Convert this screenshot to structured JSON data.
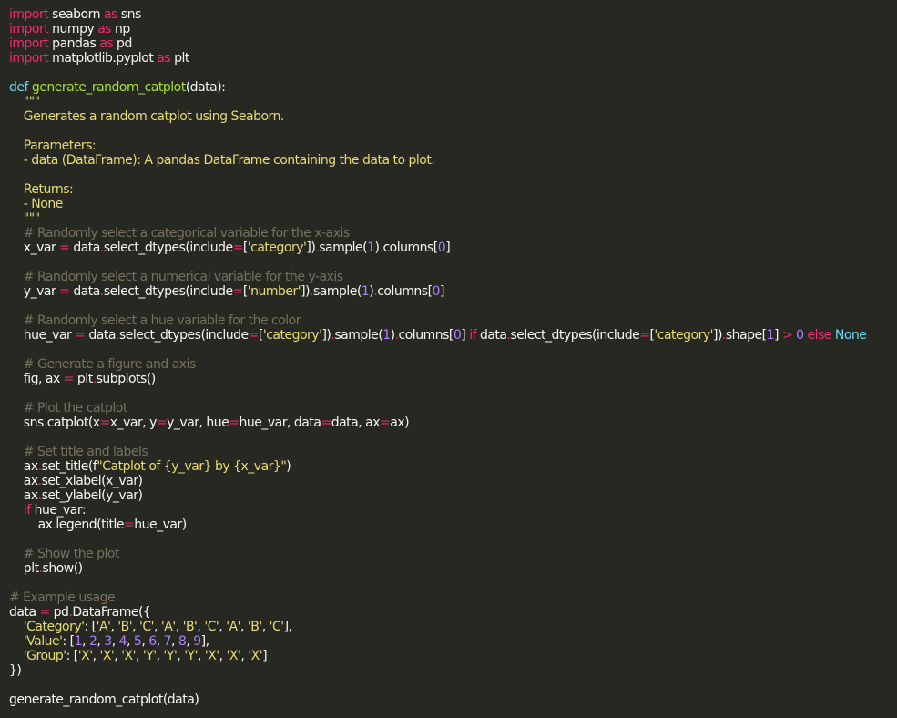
{
  "editor": {
    "theme_colors": {
      "background": "#272822",
      "text": "#f8f8f2",
      "keyword": "#66d9ef",
      "function": "#a6e22e",
      "string": "#e6db74",
      "comment": "#75715e",
      "number": "#ae81ff",
      "operator": "#f92672"
    },
    "lines": [
      [
        {
          "t": "import",
          "c": "import"
        },
        {
          "t": " seaborn ",
          "c": "plain"
        },
        {
          "t": "as",
          "c": "import"
        },
        {
          "t": " sns",
          "c": "plain"
        }
      ],
      [
        {
          "t": "import",
          "c": "import"
        },
        {
          "t": " numpy ",
          "c": "plain"
        },
        {
          "t": "as",
          "c": "import"
        },
        {
          "t": " np",
          "c": "plain"
        }
      ],
      [
        {
          "t": "import",
          "c": "import"
        },
        {
          "t": " pandas ",
          "c": "plain"
        },
        {
          "t": "as",
          "c": "import"
        },
        {
          "t": " pd",
          "c": "plain"
        }
      ],
      [
        {
          "t": "import",
          "c": "import"
        },
        {
          "t": " matplotlib.pyplot ",
          "c": "plain"
        },
        {
          "t": "as",
          "c": "import"
        },
        {
          "t": " plt",
          "c": "plain"
        }
      ],
      [],
      [
        {
          "t": "def",
          "c": "keyword"
        },
        {
          "t": " ",
          "c": "plain"
        },
        {
          "t": "generate_random_catplot",
          "c": "func"
        },
        {
          "t": "(data):",
          "c": "plain"
        }
      ],
      [
        {
          "t": "    \"\"\"",
          "c": "docstring"
        }
      ],
      [
        {
          "t": "    Generates a random catplot using Seaborn.",
          "c": "docstring"
        }
      ],
      [],
      [
        {
          "t": "    Parameters:",
          "c": "docstring"
        }
      ],
      [
        {
          "t": "    - data (DataFrame): A pandas DataFrame containing the data to plot.",
          "c": "docstring"
        }
      ],
      [],
      [
        {
          "t": "    Returns:",
          "c": "docstring"
        }
      ],
      [
        {
          "t": "    - None",
          "c": "docstring"
        }
      ],
      [
        {
          "t": "    \"\"\"",
          "c": "docstring"
        }
      ],
      [
        {
          "t": "    # Randomly select a categorical variable for the x-axis",
          "c": "comment"
        }
      ],
      [
        {
          "t": "    x_var ",
          "c": "plain"
        },
        {
          "t": "=",
          "c": "op"
        },
        {
          "t": " data",
          "c": "plain"
        },
        {
          "t": ".",
          "c": "op"
        },
        {
          "t": "select_dtypes(include",
          "c": "plain"
        },
        {
          "t": "=",
          "c": "op"
        },
        {
          "t": "[",
          "c": "plain"
        },
        {
          "t": "'category'",
          "c": "string"
        },
        {
          "t": "])",
          "c": "plain"
        },
        {
          "t": ".",
          "c": "op"
        },
        {
          "t": "sample(",
          "c": "plain"
        },
        {
          "t": "1",
          "c": "number"
        },
        {
          "t": ")",
          "c": "plain"
        },
        {
          "t": ".",
          "c": "op"
        },
        {
          "t": "columns[",
          "c": "plain"
        },
        {
          "t": "0",
          "c": "number"
        },
        {
          "t": "]",
          "c": "plain"
        }
      ],
      [],
      [
        {
          "t": "    # Randomly select a numerical variable for the y-axis",
          "c": "comment"
        }
      ],
      [
        {
          "t": "    y_var ",
          "c": "plain"
        },
        {
          "t": "=",
          "c": "op"
        },
        {
          "t": " data",
          "c": "plain"
        },
        {
          "t": ".",
          "c": "op"
        },
        {
          "t": "select_dtypes(include",
          "c": "plain"
        },
        {
          "t": "=",
          "c": "op"
        },
        {
          "t": "[",
          "c": "plain"
        },
        {
          "t": "'number'",
          "c": "string"
        },
        {
          "t": "])",
          "c": "plain"
        },
        {
          "t": ".",
          "c": "op"
        },
        {
          "t": "sample(",
          "c": "plain"
        },
        {
          "t": "1",
          "c": "number"
        },
        {
          "t": ")",
          "c": "plain"
        },
        {
          "t": ".",
          "c": "op"
        },
        {
          "t": "columns[",
          "c": "plain"
        },
        {
          "t": "0",
          "c": "number"
        },
        {
          "t": "]",
          "c": "plain"
        }
      ],
      [],
      [
        {
          "t": "    # Randomly select a hue variable for the color",
          "c": "comment"
        }
      ],
      [
        {
          "t": "    hue_var ",
          "c": "plain"
        },
        {
          "t": "=",
          "c": "op"
        },
        {
          "t": " data",
          "c": "plain"
        },
        {
          "t": ".",
          "c": "op"
        },
        {
          "t": "select_dtypes(include",
          "c": "plain"
        },
        {
          "t": "=",
          "c": "op"
        },
        {
          "t": "[",
          "c": "plain"
        },
        {
          "t": "'category'",
          "c": "string"
        },
        {
          "t": "])",
          "c": "plain"
        },
        {
          "t": ".",
          "c": "op"
        },
        {
          "t": "sample(",
          "c": "plain"
        },
        {
          "t": "1",
          "c": "number"
        },
        {
          "t": ")",
          "c": "plain"
        },
        {
          "t": ".",
          "c": "op"
        },
        {
          "t": "columns[",
          "c": "plain"
        },
        {
          "t": "0",
          "c": "number"
        },
        {
          "t": "] ",
          "c": "plain"
        },
        {
          "t": "if",
          "c": "import"
        },
        {
          "t": " data",
          "c": "plain"
        },
        {
          "t": ".",
          "c": "op"
        },
        {
          "t": "select_dtypes(include",
          "c": "plain"
        },
        {
          "t": "=",
          "c": "op"
        },
        {
          "t": "[",
          "c": "plain"
        },
        {
          "t": "'category'",
          "c": "string"
        },
        {
          "t": "])",
          "c": "plain"
        },
        {
          "t": ".",
          "c": "op"
        },
        {
          "t": "shape[",
          "c": "plain"
        },
        {
          "t": "1",
          "c": "number"
        },
        {
          "t": "] ",
          "c": "plain"
        },
        {
          "t": ">",
          "c": "op"
        },
        {
          "t": " ",
          "c": "plain"
        },
        {
          "t": "0",
          "c": "number"
        },
        {
          "t": " ",
          "c": "plain"
        },
        {
          "t": "else",
          "c": "import"
        },
        {
          "t": " ",
          "c": "plain"
        },
        {
          "t": "None",
          "c": "keyword"
        }
      ],
      [],
      [
        {
          "t": "    # Generate a figure and axis",
          "c": "comment"
        }
      ],
      [
        {
          "t": "    fig, ax ",
          "c": "plain"
        },
        {
          "t": "=",
          "c": "op"
        },
        {
          "t": " plt",
          "c": "plain"
        },
        {
          "t": ".",
          "c": "op"
        },
        {
          "t": "subplots()",
          "c": "plain"
        }
      ],
      [],
      [
        {
          "t": "    # Plot the catplot",
          "c": "comment"
        }
      ],
      [
        {
          "t": "    sns",
          "c": "plain"
        },
        {
          "t": ".",
          "c": "op"
        },
        {
          "t": "catplot(x",
          "c": "plain"
        },
        {
          "t": "=",
          "c": "op"
        },
        {
          "t": "x_var, y",
          "c": "plain"
        },
        {
          "t": "=",
          "c": "op"
        },
        {
          "t": "y_var, hue",
          "c": "plain"
        },
        {
          "t": "=",
          "c": "op"
        },
        {
          "t": "hue_var, data",
          "c": "plain"
        },
        {
          "t": "=",
          "c": "op"
        },
        {
          "t": "data, ax",
          "c": "plain"
        },
        {
          "t": "=",
          "c": "op"
        },
        {
          "t": "ax)",
          "c": "plain"
        }
      ],
      [],
      [
        {
          "t": "    # Set title and labels",
          "c": "comment"
        }
      ],
      [
        {
          "t": "    ax",
          "c": "plain"
        },
        {
          "t": ".",
          "c": "op"
        },
        {
          "t": "set_title(f",
          "c": "plain"
        },
        {
          "t": "\"Catplot of {y_var} by {x_var}\"",
          "c": "string"
        },
        {
          "t": ")",
          "c": "plain"
        }
      ],
      [
        {
          "t": "    ax",
          "c": "plain"
        },
        {
          "t": ".",
          "c": "op"
        },
        {
          "t": "set_xlabel(x_var)",
          "c": "plain"
        }
      ],
      [
        {
          "t": "    ax",
          "c": "plain"
        },
        {
          "t": ".",
          "c": "op"
        },
        {
          "t": "set_ylabel(y_var)",
          "c": "plain"
        }
      ],
      [
        {
          "t": "    ",
          "c": "plain"
        },
        {
          "t": "if",
          "c": "import"
        },
        {
          "t": " hue_var:",
          "c": "plain"
        }
      ],
      [
        {
          "t": "        ax",
          "c": "plain"
        },
        {
          "t": ".",
          "c": "op"
        },
        {
          "t": "legend(title",
          "c": "plain"
        },
        {
          "t": "=",
          "c": "op"
        },
        {
          "t": "hue_var)",
          "c": "plain"
        }
      ],
      [],
      [
        {
          "t": "    # Show the plot",
          "c": "comment"
        }
      ],
      [
        {
          "t": "    plt",
          "c": "plain"
        },
        {
          "t": ".",
          "c": "op"
        },
        {
          "t": "show()",
          "c": "plain"
        }
      ],
      [],
      [
        {
          "t": "# Example usage",
          "c": "comment"
        }
      ],
      [
        {
          "t": "data ",
          "c": "plain"
        },
        {
          "t": "=",
          "c": "op"
        },
        {
          "t": " pd",
          "c": "plain"
        },
        {
          "t": ".",
          "c": "op"
        },
        {
          "t": "DataFrame({",
          "c": "plain"
        }
      ],
      [
        {
          "t": "    ",
          "c": "plain"
        },
        {
          "t": "'Category'",
          "c": "string"
        },
        {
          "t": ": [",
          "c": "plain"
        },
        {
          "t": "'A'",
          "c": "string"
        },
        {
          "t": ", ",
          "c": "plain"
        },
        {
          "t": "'B'",
          "c": "string"
        },
        {
          "t": ", ",
          "c": "plain"
        },
        {
          "t": "'C'",
          "c": "string"
        },
        {
          "t": ", ",
          "c": "plain"
        },
        {
          "t": "'A'",
          "c": "string"
        },
        {
          "t": ", ",
          "c": "plain"
        },
        {
          "t": "'B'",
          "c": "string"
        },
        {
          "t": ", ",
          "c": "plain"
        },
        {
          "t": "'C'",
          "c": "string"
        },
        {
          "t": ", ",
          "c": "plain"
        },
        {
          "t": "'A'",
          "c": "string"
        },
        {
          "t": ", ",
          "c": "plain"
        },
        {
          "t": "'B'",
          "c": "string"
        },
        {
          "t": ", ",
          "c": "plain"
        },
        {
          "t": "'C'",
          "c": "string"
        },
        {
          "t": "],",
          "c": "plain"
        }
      ],
      [
        {
          "t": "    ",
          "c": "plain"
        },
        {
          "t": "'Value'",
          "c": "string"
        },
        {
          "t": ": [",
          "c": "plain"
        },
        {
          "t": "1",
          "c": "number"
        },
        {
          "t": ", ",
          "c": "plain"
        },
        {
          "t": "2",
          "c": "number"
        },
        {
          "t": ", ",
          "c": "plain"
        },
        {
          "t": "3",
          "c": "number"
        },
        {
          "t": ", ",
          "c": "plain"
        },
        {
          "t": "4",
          "c": "number"
        },
        {
          "t": ", ",
          "c": "plain"
        },
        {
          "t": "5",
          "c": "number"
        },
        {
          "t": ", ",
          "c": "plain"
        },
        {
          "t": "6",
          "c": "number"
        },
        {
          "t": ", ",
          "c": "plain"
        },
        {
          "t": "7",
          "c": "number"
        },
        {
          "t": ", ",
          "c": "plain"
        },
        {
          "t": "8",
          "c": "number"
        },
        {
          "t": ", ",
          "c": "plain"
        },
        {
          "t": "9",
          "c": "number"
        },
        {
          "t": "],",
          "c": "plain"
        }
      ],
      [
        {
          "t": "    ",
          "c": "plain"
        },
        {
          "t": "'Group'",
          "c": "string"
        },
        {
          "t": ": [",
          "c": "plain"
        },
        {
          "t": "'X'",
          "c": "string"
        },
        {
          "t": ", ",
          "c": "plain"
        },
        {
          "t": "'X'",
          "c": "string"
        },
        {
          "t": ", ",
          "c": "plain"
        },
        {
          "t": "'X'",
          "c": "string"
        },
        {
          "t": ", ",
          "c": "plain"
        },
        {
          "t": "'Y'",
          "c": "string"
        },
        {
          "t": ", ",
          "c": "plain"
        },
        {
          "t": "'Y'",
          "c": "string"
        },
        {
          "t": ", ",
          "c": "plain"
        },
        {
          "t": "'Y'",
          "c": "string"
        },
        {
          "t": ", ",
          "c": "plain"
        },
        {
          "t": "'X'",
          "c": "string"
        },
        {
          "t": ", ",
          "c": "plain"
        },
        {
          "t": "'X'",
          "c": "string"
        },
        {
          "t": ", ",
          "c": "plain"
        },
        {
          "t": "'X'",
          "c": "string"
        },
        {
          "t": "]",
          "c": "plain"
        }
      ],
      [
        {
          "t": "})",
          "c": "plain"
        }
      ],
      [],
      [
        {
          "t": "generate_random_catplot(data)",
          "c": "plain"
        }
      ]
    ]
  }
}
